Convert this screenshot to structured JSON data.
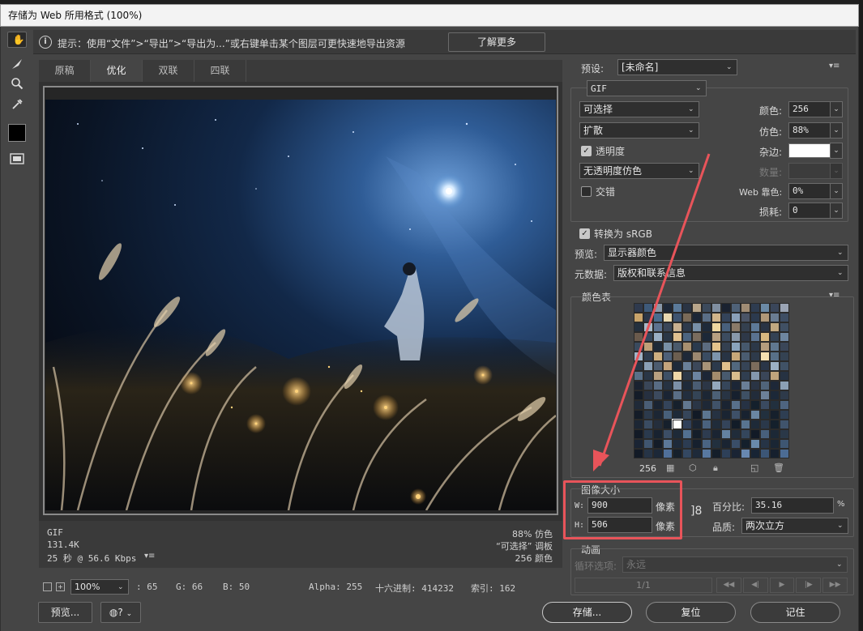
{
  "window": {
    "title": "存储为 Web 所用格式 (100%)"
  },
  "hint": {
    "text": "提示：使用“文件”>“导出”>“导出为...”或右键单击某个图层可更快速地导出资源",
    "learn_more": "了解更多"
  },
  "tabs": [
    {
      "label": "原稿",
      "active": false
    },
    {
      "label": "优化",
      "active": true
    },
    {
      "label": "双联",
      "active": false
    },
    {
      "label": "四联",
      "active": false
    }
  ],
  "image_info": {
    "format": "GIF",
    "size": "131.4K",
    "time": "25 秒 @ 56.6 Kbps",
    "dither": "88% 仿色",
    "palette": "“可选择” 调板",
    "colors": "256 颜色"
  },
  "status": {
    "zoom": "100%",
    "r": ": 65",
    "g": "G: 66",
    "b": "B: 50",
    "alpha": "Alpha: 255",
    "hex": "十六进制: 414232",
    "index": "索引: 162"
  },
  "bottom_buttons": {
    "preview": "预览...",
    "save": "存储...",
    "reset": "复位",
    "remember": "记住"
  },
  "settings": {
    "preset_label": "预设:",
    "preset_value": "[未命名]",
    "format": "GIF",
    "reduction": "可选择",
    "dither_algo": "扩散",
    "transparency_label": "透明度",
    "transparency_checked": true,
    "trans_dither": "无透明度仿色",
    "interlaced_label": "交错",
    "interlaced_checked": false,
    "colors_label": "颜色:",
    "colors_value": "256",
    "dither_label": "仿色:",
    "dither_value": "88%",
    "matte_label": "杂边:",
    "amount_label": "数量:",
    "websnap_label": "Web 靠色:",
    "websnap_value": "0%",
    "lossy_label": "损耗:",
    "lossy_value": "0",
    "convert_srgb_label": "转换为 sRGB",
    "convert_srgb_checked": true,
    "preview_label": "预览:",
    "preview_value": "显示器颜色",
    "metadata_label": "元数据:",
    "metadata_value": "版权和联系信息"
  },
  "color_table": {
    "title": "颜色表",
    "count": "256",
    "colors": [
      "#2f3a4e",
      "#3e5a7a",
      "#8a98a8",
      "#1e2838",
      "#5b7a9a",
      "#2a3444",
      "#b8a58a",
      "#3c4a5c",
      "#7f8ea0",
      "#1a2230",
      "#4f6278",
      "#a08c74",
      "#2e3c50",
      "#6b8aa6",
      "#3a465a",
      "#9aa4b4",
      "#c9a46a",
      "#2a3648",
      "#4a6c8e",
      "#e8d8b0",
      "#3f5470",
      "#7a6a58",
      "#1c2636",
      "#5a6e86",
      "#d0b48a",
      "#34445a",
      "#8aa0b8",
      "#4a5466",
      "#2c3a4e",
      "#b09878",
      "#6a7c92",
      "#3e4e64",
      "#24303e",
      "#a8b8c8",
      "#5c7290",
      "#3a4658",
      "#c8b090",
      "#2e3a4c",
      "#7890a8",
      "#1e2a3a",
      "#f0d8a0",
      "#48607c",
      "#8a7a68",
      "#34404f",
      "#5e7a98",
      "#2a3444",
      "#c0a880",
      "#405064",
      "#6a5a4c",
      "#34465c",
      "#9ab0c6",
      "#2a3646",
      "#e0c090",
      "#4c6480",
      "#7a6c5e",
      "#1c2838",
      "#b8a080",
      "#3c4c60",
      "#8898aa",
      "#2e3848",
      "#5a7290",
      "#d8b880",
      "#344254",
      "#6e86a0",
      "#3a4a5e",
      "#c0a078",
      "#1e2a38",
      "#7890a6",
      "#4a5a6c",
      "#a89070",
      "#2a3a4e",
      "#5c6c80",
      "#e4c48c",
      "#344050",
      "#8aa4bc",
      "#46586c",
      "#2c3848",
      "#b49c7c",
      "#607890",
      "#3a4658",
      "#a0b4c8",
      "#2e3c4e",
      "#d0b080",
      "#4e6078",
      "#6c5e50",
      "#1e2838",
      "#9c8870",
      "#3a4c62",
      "#7c94ac",
      "#283444",
      "#c8a878",
      "#4a5c70",
      "#2e3a4a",
      "#f4e0b0",
      "#587088",
      "#344252",
      "#283646",
      "#8aa0b6",
      "#4c5c70",
      "#c4a47c",
      "#1e2a3a",
      "#6a8098",
      "#3c485a",
      "#a89478",
      "#2c3a4c",
      "#e0c08c",
      "#52687e",
      "#364456",
      "#7c6c5c",
      "#2a3648",
      "#9cb0c4",
      "#405266",
      "#5a7088",
      "#2a3646",
      "#b8a080",
      "#3e5066",
      "#f0d8a8",
      "#2c3848",
      "#6c84a0",
      "#1c2636",
      "#a48c6c",
      "#485a6e",
      "#d8bc8c",
      "#303e50",
      "#8498ae",
      "#3a4658",
      "#c0a47c",
      "#263242",
      "#1a2230",
      "#3a4658",
      "#586c84",
      "#263242",
      "#7c90a8",
      "#1e2a3a",
      "#4a5c72",
      "#2c3646",
      "#94a8bc",
      "#36465a",
      "#1c2636",
      "#6a7e96",
      "#2a3444",
      "#50647a",
      "#1e2838",
      "#8ca0b4",
      "#141c28",
      "#263040",
      "#3c4a5e",
      "#1a2434",
      "#5a6e86",
      "#222e3e",
      "#344456",
      "#1c2634",
      "#4c6076",
      "#283444",
      "#16202e",
      "#3e5064",
      "#222c3a",
      "#6c8098",
      "#1c2838",
      "#2e3a4a",
      "#202a38",
      "#4a5e76",
      "#1a2432",
      "#34445a",
      "#16202c",
      "#627890",
      "#2a3646",
      "#1e2836",
      "#405268",
      "#1a2432",
      "#58708a",
      "#263244",
      "#14202c",
      "#3a4a60",
      "#22303e",
      "#4e6480",
      "#141c28",
      "#2c3a4c",
      "#1c2634",
      "#48607a",
      "#1e2a38",
      "#36465a",
      "#121a26",
      "#5c7690",
      "#263242",
      "#1a2432",
      "#3e5068",
      "#182230",
      "#6a86a2",
      "#22303e",
      "#16202c",
      "#2e3e52",
      "#1c2634",
      "#3a4c62",
      "#242e3c",
      "#16202c",
      "#ffffff",
      "#30405a",
      "#1a2432",
      "#4a627e",
      "#202c3a",
      "#34445a",
      "#121c28",
      "#587490",
      "#1e2a38",
      "#2a384a",
      "#14202c",
      "#40546c",
      "#121a26",
      "#2a3a4e",
      "#182230",
      "#3c4e66",
      "#1e2a38",
      "#527090",
      "#141e2a",
      "#2e3c50",
      "#1a2432",
      "#6482a0",
      "#202c3a",
      "#34465c",
      "#121a26",
      "#48607c",
      "#1c2836",
      "#2a3848",
      "#1a2434",
      "#405670",
      "#141c28",
      "#5c7898",
      "#1e2a3a",
      "#2c3c52",
      "#16202e",
      "#4a6482",
      "#22303e",
      "#1a2432",
      "#3a4e68",
      "#14202c",
      "#6a8aaa",
      "#263446",
      "#1a2634",
      "#3e5672",
      "#121a26",
      "#263446",
      "#1c2838",
      "#50709a",
      "#16202c",
      "#344862",
      "#1e2a3a",
      "#5878a0",
      "#141e2a",
      "#2e4058",
      "#1a2434",
      "#6888b0",
      "#182434",
      "#3c5676",
      "#16202e",
      "#4c6c94"
    ]
  },
  "image_size": {
    "title": "图像大小",
    "w_label": "W:",
    "w_value": "900",
    "h_label": "H:",
    "h_value": "506",
    "unit": "像素",
    "percent_label": "百分比:",
    "percent_value": "35.16",
    "percent_unit": "%",
    "quality_label": "品质:",
    "quality_value": "两次立方"
  },
  "animation": {
    "title": "动画",
    "loop_label": "循环选项:",
    "loop_value": "永远",
    "frame": "1/1"
  },
  "colors": {
    "accent_red": "#e8545a"
  }
}
